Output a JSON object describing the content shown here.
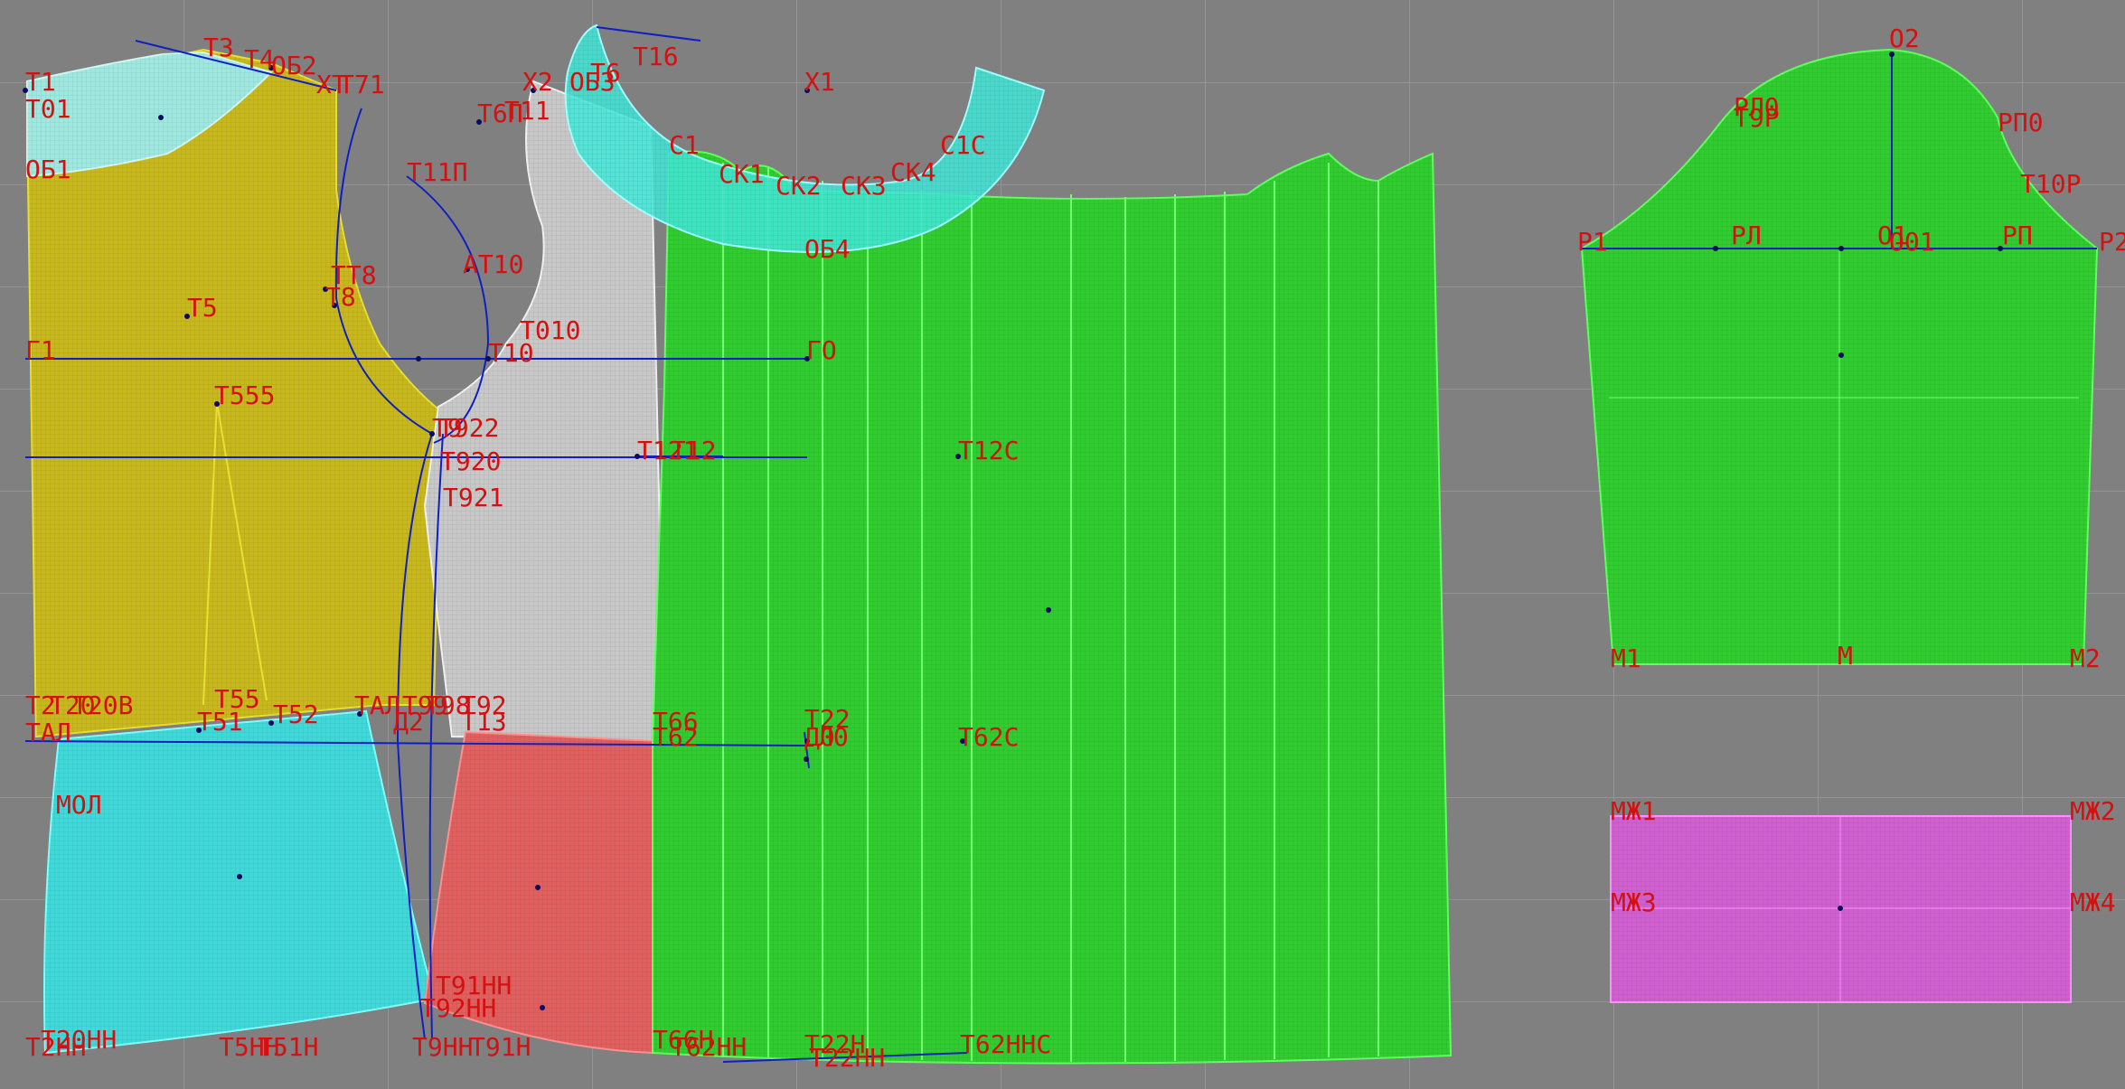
{
  "colors": {
    "background": "#808080",
    "grid": "#9a9a9a",
    "label": "#d41010",
    "construction_line": "#1020c0",
    "piece_yellow": "#c8b81e",
    "piece_white": "#c8c8c8",
    "piece_cyan": "#40d8d8",
    "piece_cyan_light": "#9fe8e0",
    "piece_red": "#e06060",
    "piece_green": "#30cc30",
    "piece_magenta": "#d060d0"
  },
  "labels": {
    "t1": "T1",
    "t01": "T01",
    "ob1": "OБ1",
    "t3": "T3",
    "t4": "T4",
    "ob2": "OБ2",
    "t7": "T7",
    "xt": "XT",
    "t71": "T71",
    "x2": "X2",
    "ob3": "OБ3",
    "t6": "T6",
    "t16": "T16",
    "x1": "X1",
    "t6p": "T6П",
    "t11": "T11",
    "t11p": "T11П",
    "at10": "AT10",
    "tt8": "TT8",
    "t8": "T8",
    "t5": "T5",
    "t010": "T010",
    "g1": "Г1",
    "t10": "T10",
    "go": "ГO",
    "t555": "T555",
    "t922": "T922",
    "t9": "T9",
    "t920": "T920",
    "t921": "T921",
    "t121": "T121",
    "t12": "T12",
    "t12c": "T12C",
    "c1": "C1",
    "ck1": "CK1",
    "ck2": "CK2",
    "ck3": "CK3",
    "ck4": "CK4",
    "c1c": "C1C",
    "ob4": "OБ4",
    "t2": "T2",
    "t20": "T20",
    "t20b": "T20B",
    "t55": "T55",
    "t51": "T51",
    "t52": "T52",
    "tal": "TAЛ",
    "d2": "Д2",
    "t99": "T99",
    "t13": "T13",
    "t98": "T98",
    "t92": "T92",
    "tal2": "TAЛ",
    "t66": "T66",
    "t62": "T62",
    "t22": "T22",
    "d0": "Д0",
    "l0": "Л0",
    "t62c": "T62C",
    "mol": "MOЛ",
    "t91hh": "T91HH",
    "t92hh": "T92HH",
    "t20hh": "T20HH",
    "t2hh": "T2HH",
    "t5hh": "T5HH",
    "t51h": "T51H",
    "t9hh": "T9HH",
    "t91h": "T91H",
    "t66h": "T66H",
    "t62hh": "T62HH",
    "t22h": "T22H",
    "t22hh": "T22HH",
    "t62hhc": "T62HHC",
    "o2": "O2",
    "rl0": "PЛ0",
    "t9r": "T9P",
    "rp0": "PП0",
    "t10r": "T10P",
    "r1": "P1",
    "rl": "PЛ",
    "o1": "O1",
    "o01": "O01",
    "rp": "PП",
    "r2": "P2",
    "m1": "M1",
    "m": "M",
    "m2": "M2",
    "mzh1": "MЖ1",
    "mzh2": "MЖ2",
    "mzh3": "MЖ3",
    "mzh4": "MЖ4"
  }
}
